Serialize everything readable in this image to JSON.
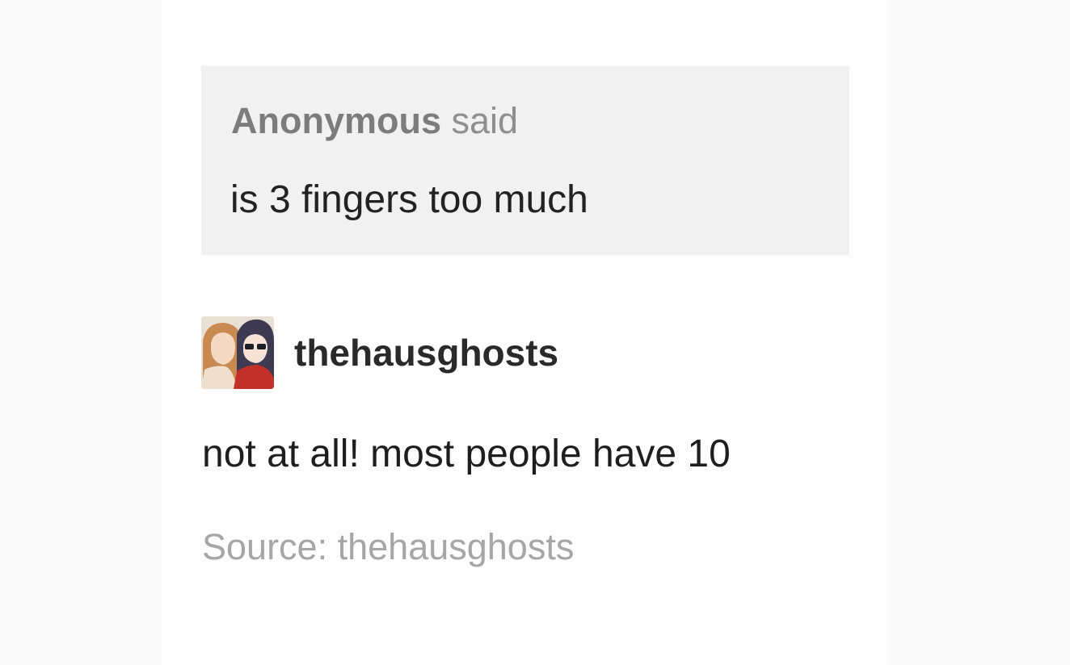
{
  "ask": {
    "asker": "Anonymous",
    "verb": "said",
    "question": "is 3 fingers too much"
  },
  "answer": {
    "avatar_icon": "user-avatar-icon",
    "username": "thehausghosts",
    "text": "not at all! most people have 10"
  },
  "source": {
    "label": "Source:",
    "name": "thehausghosts"
  }
}
